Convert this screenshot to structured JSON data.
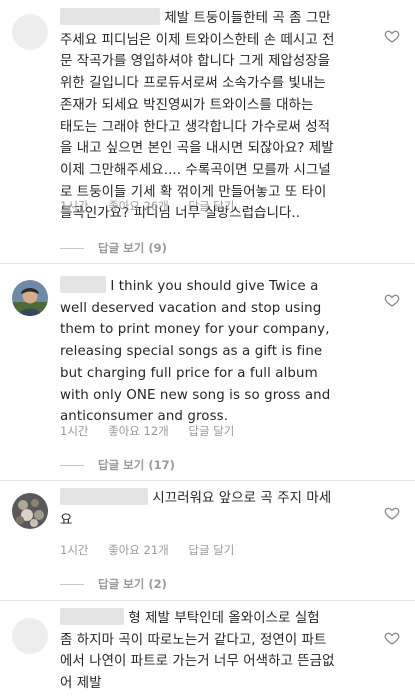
{
  "comments": [
    {
      "text": " 제발 트둥이들한테 곡 좀 그만\n주세요 피디님은 이제 트와이스한테 손 떼시고 전\n문 작곡가를 영입하셔야 합니다 그게 제압성장을\n위한 길입니다 프로듀서로써 소속가수를 빛내는\n존재가 되세요 박진영씨가 트와이스를 대하는\n태도는 그래야 한다고 생각합니다 가수로써 성적\n을 내고 싶으면 본인 곡을 내시면 되잖아요? 제발\n이제 그만해주세요.... 수록곡이면 모를까 시그널\n로 트둥이들 기세 확 꺾이게 만들어놓고 또 타이\n틀곡인가요? 피디님 너무 실망스럽습니다..",
      "time": "1시간",
      "likes": "좋아요 26개",
      "reply": "답글 달기",
      "view_replies": "답글 보기 (9)"
    },
    {
      "text": " I think you should give Twice a\nwell deserved vacation and stop using\nthem to print money for your company,\nreleasing special songs as a gift is fine\nbut charging full price for a full album\nwith only ONE new song is so gross and\nanticonsumer and gross.",
      "time": "1시간",
      "likes": "좋아요 12개",
      "reply": "답글 달기",
      "view_replies": "답글 보기 (17)"
    },
    {
      "text": " 시끄러워요 앞으로 곡 주지 마세\n요",
      "time": "1시간",
      "likes": "좋아요 21개",
      "reply": "답글 달기",
      "view_replies": "답글 보기 (2)"
    },
    {
      "text": " 형 제발 부탁인데 올와이스로 실험\n좀 하지마 곡이 따로노는거 같다고, 정연이 파트\n에서 나연이 파트로 가는거 너무 어색하고 뜬금없\n어 제발"
    }
  ]
}
